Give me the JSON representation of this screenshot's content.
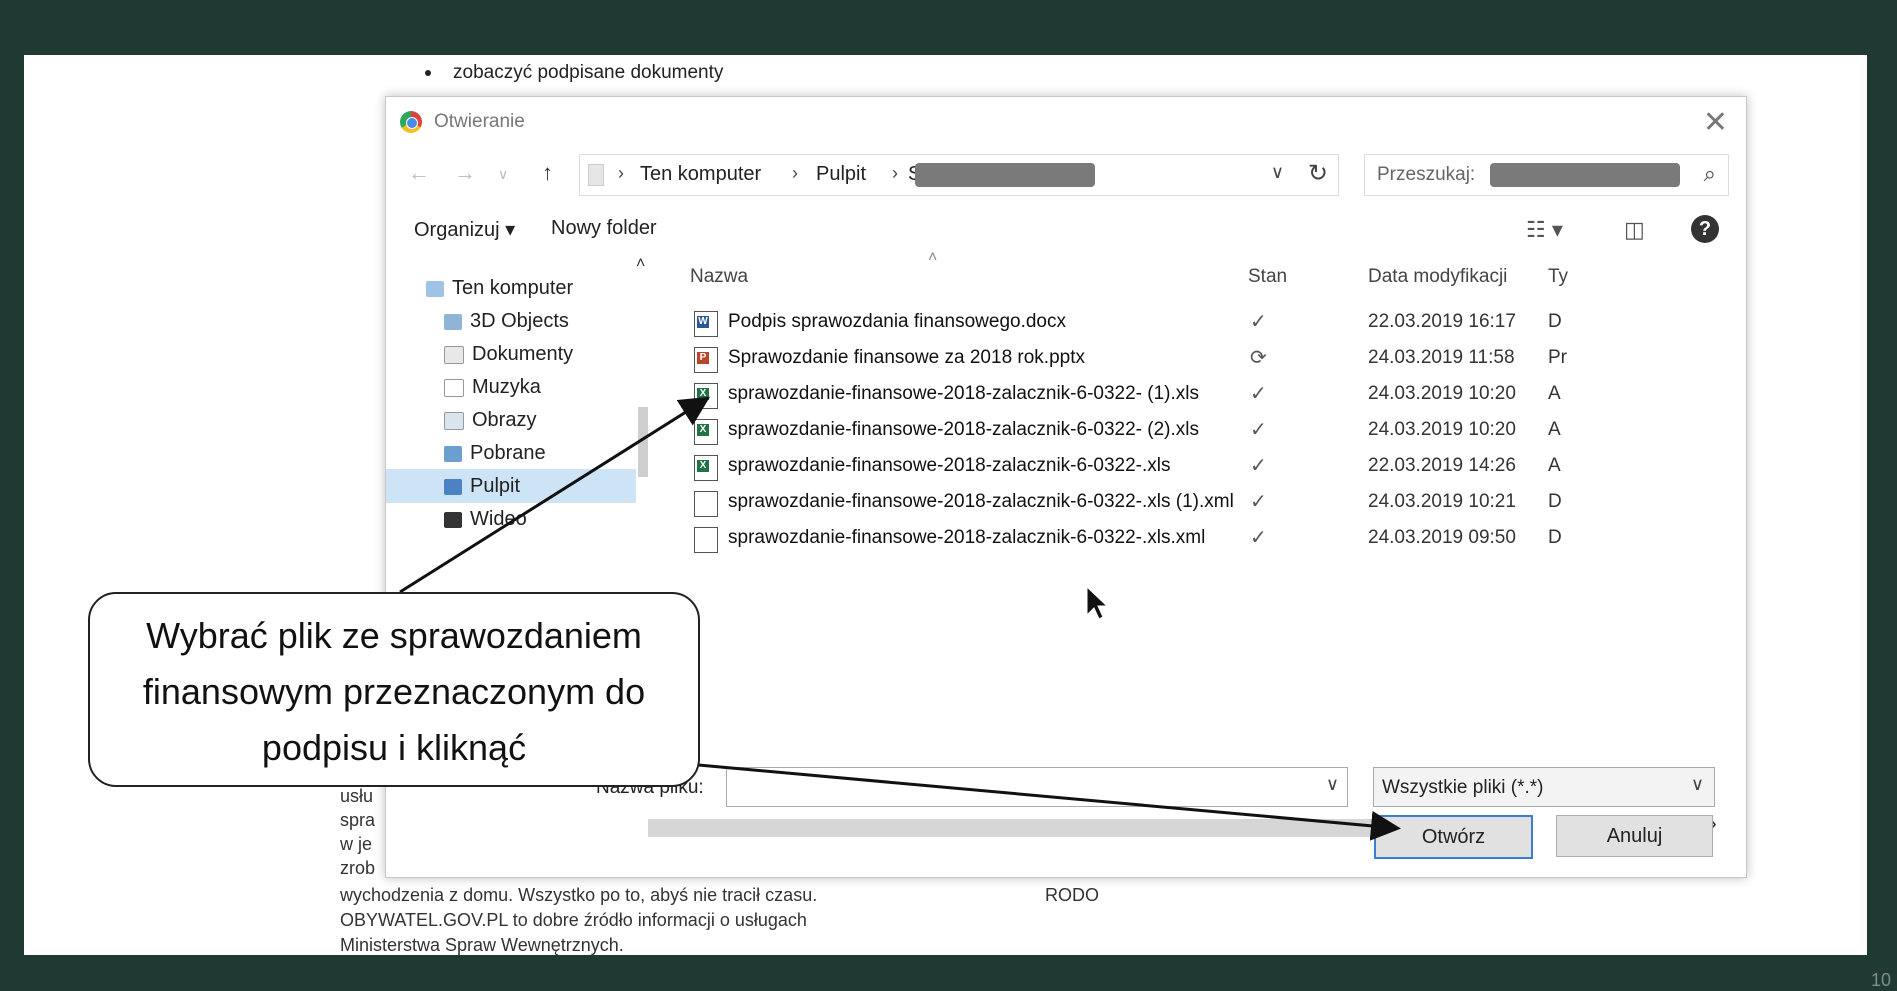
{
  "slide": {
    "bullet": "zobaczyć podpisane dokumenty",
    "under_lines": [
      "usłu",
      "spra",
      "w je",
      "zrob"
    ],
    "body_lines": [
      "wychodzenia z domu. Wszystko po to, abyś nie tracił czasu.",
      "OBYWATEL.GOV.PL to dobre źródło informacji o usługach",
      "Ministerstwa Spraw Wewnętrznych."
    ],
    "rodo": "RODO",
    "page_number": "10"
  },
  "dialog": {
    "title": "Otwieranie",
    "address": {
      "crumbs": [
        "Ten komputer",
        "Pulpit",
        "S"
      ]
    },
    "search_label": "Przeszukaj:",
    "toolbar": {
      "organize": "Organizuj ▾",
      "new_folder": "Nowy folder"
    },
    "nav_items": [
      "Ten komputer",
      "3D Objects",
      "Dokumenty",
      "Muzyka",
      "Obrazy",
      "Pobrane",
      "Pulpit",
      "Wideo"
    ],
    "columns": {
      "name": "Nazwa",
      "state": "Stan",
      "date": "Data modyfikacji",
      "type": "Ty"
    },
    "files": [
      {
        "name": "Podpis sprawozdania finansowego.docx",
        "state": "✓",
        "date": "22.03.2019 16:17",
        "type": "D",
        "icon": "word-icon"
      },
      {
        "name": "Sprawozdanie finansowe za 2018 rok.pptx",
        "state": "⟳",
        "date": "24.03.2019 11:58",
        "type": "Pr",
        "icon": "powerpoint-icon"
      },
      {
        "name": "sprawozdanie-finansowe-2018-zalacznik-6-0322- (1).xls",
        "state": "✓",
        "date": "24.03.2019 10:20",
        "type": "A",
        "icon": "excel-icon"
      },
      {
        "name": "sprawozdanie-finansowe-2018-zalacznik-6-0322- (2).xls",
        "state": "✓",
        "date": "24.03.2019 10:20",
        "type": "A",
        "icon": "excel-icon"
      },
      {
        "name": "sprawozdanie-finansowe-2018-zalacznik-6-0322-.xls",
        "state": "✓",
        "date": "22.03.2019 14:26",
        "type": "A",
        "icon": "excel-icon"
      },
      {
        "name": "sprawozdanie-finansowe-2018-zalacznik-6-0322-.xls (1).xml",
        "state": "✓",
        "date": "24.03.2019 10:21",
        "type": "D",
        "icon": "xml-file-icon"
      },
      {
        "name": "sprawozdanie-finansowe-2018-zalacznik-6-0322-.xls.xml",
        "state": "✓",
        "date": "24.03.2019 09:50",
        "type": "D",
        "icon": "xml-file-icon"
      }
    ],
    "filename_label": "Nazwa pliku:",
    "filter_value": "Wszystkie pliki (*.*)",
    "open_button": "Otwórz",
    "cancel_button": "Anuluj"
  },
  "callout": {
    "lines": [
      "Wybrać plik ze sprawozdaniem",
      "finansowym przeznaczonym do",
      "podpisu i kliknąć"
    ]
  }
}
